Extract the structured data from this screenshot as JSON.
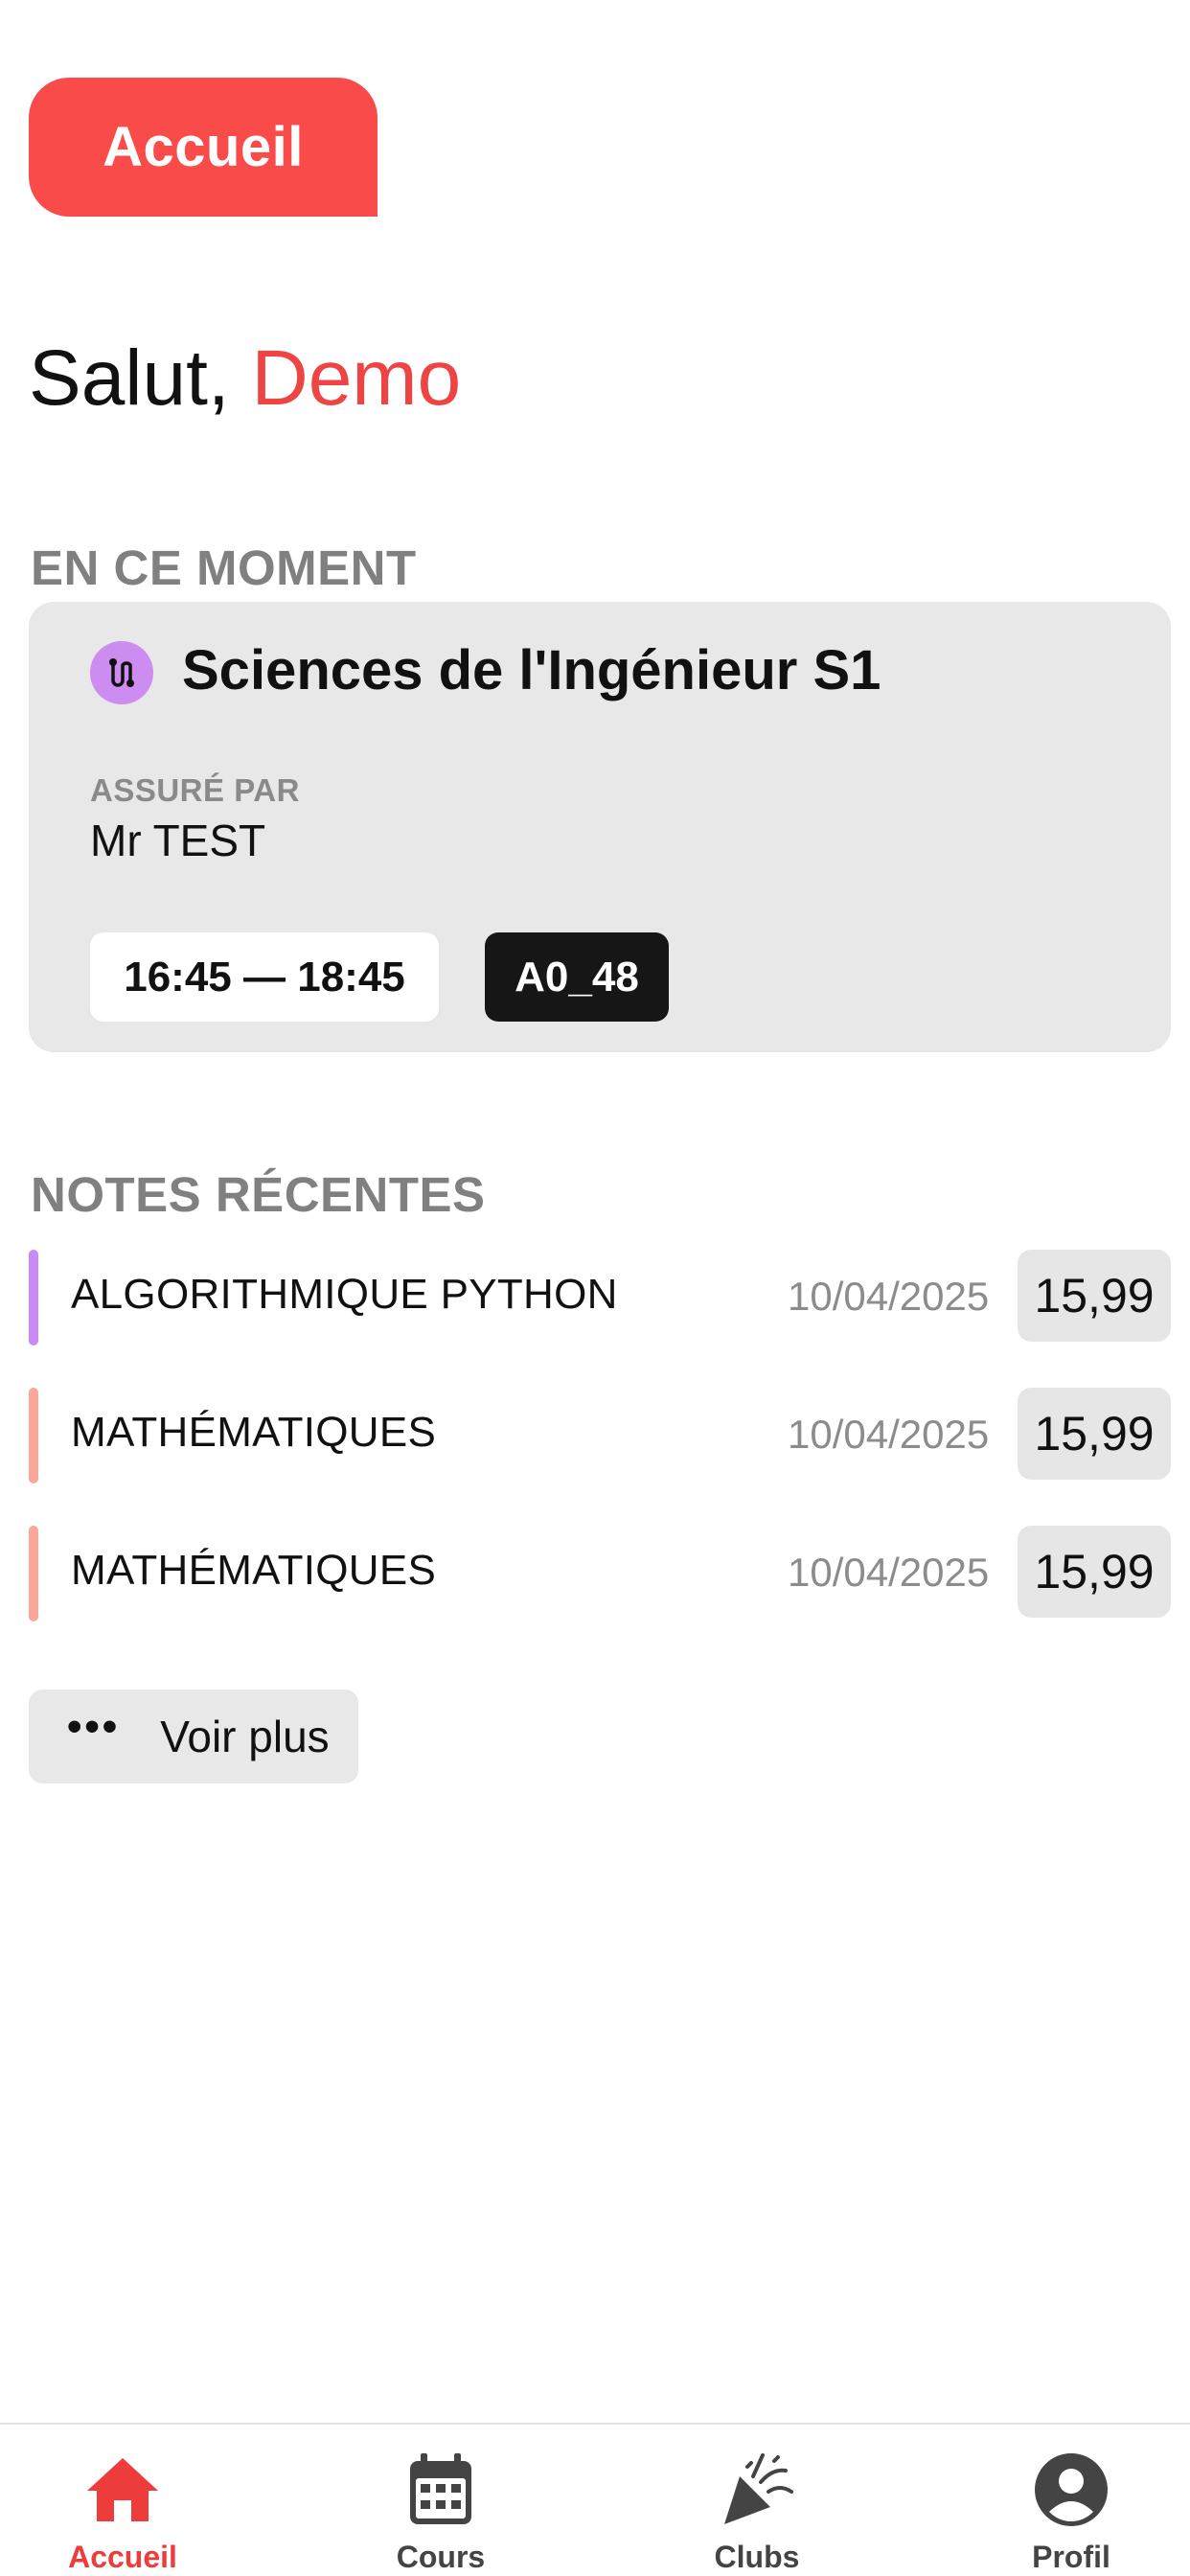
{
  "header": {
    "title": "Accueil"
  },
  "greeting": {
    "prefix": "Salut,",
    "name": "Demo"
  },
  "current": {
    "section_title": "EN CE MOMENT",
    "course": "Sciences de l'Ingénieur S1",
    "teacher_label": "ASSURÉ PAR",
    "teacher": "Mr TEST",
    "time": "16:45 — 18:45",
    "room": "A0_48",
    "icon": "route-icon",
    "icon_color": "#cd8cf0"
  },
  "grades": {
    "section_title": "NOTES RÉCENTES",
    "items": [
      {
        "subject": "ALGORITHMIQUE PYTHON",
        "date": "10/04/2025",
        "value": "15,99",
        "color": "#c98af2"
      },
      {
        "subject": "MATHÉMATIQUES",
        "date": "10/04/2025",
        "value": "15,99",
        "color": "#f7a898"
      },
      {
        "subject": "MATHÉMATIQUES",
        "date": "10/04/2025",
        "value": "15,99",
        "color": "#f7a898"
      }
    ],
    "more_label": "Voir plus"
  },
  "tabs": [
    {
      "label": "Accueil",
      "icon": "home-icon",
      "active": true
    },
    {
      "label": "Cours",
      "icon": "calendar-icon",
      "active": false
    },
    {
      "label": "Clubs",
      "icon": "party-popper-icon",
      "active": false
    },
    {
      "label": "Profil",
      "icon": "profile-icon",
      "active": false
    }
  ],
  "colors": {
    "accent": "#fa4b4b",
    "active_tab": "#ee3b3b"
  }
}
